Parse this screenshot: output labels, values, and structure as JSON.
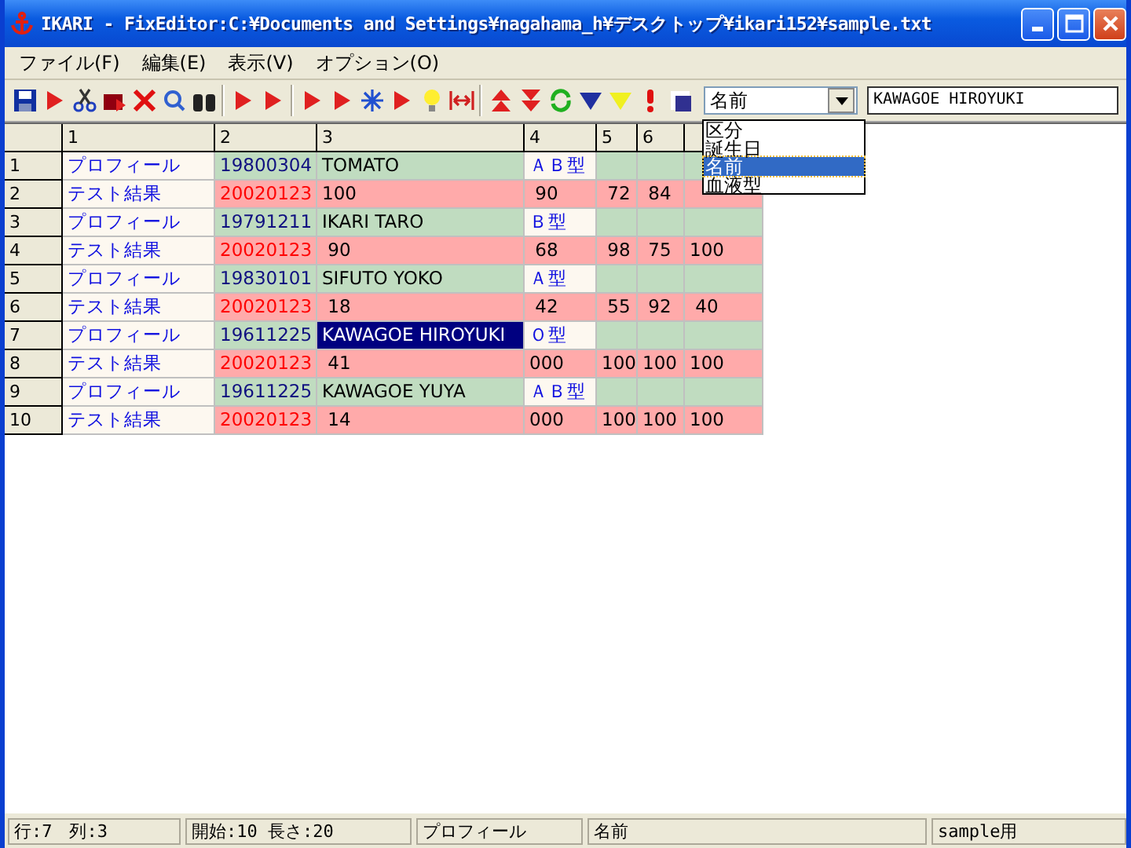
{
  "window": {
    "title": "IKARI - FixEditor:C:¥Documents and Settings¥nagahama_h¥デスクトップ¥ikari152¥sample.txt"
  },
  "menu": [
    "ファイル(F)",
    "編集(E)",
    "表示(V)",
    "オプション(O)"
  ],
  "field_selector": {
    "value": "名前",
    "expanded": true,
    "options": [
      {
        "label": "区分",
        "selected": false
      },
      {
        "label": "誕生日",
        "selected": false
      },
      {
        "label": "名前",
        "selected": true
      },
      {
        "label": "血液型",
        "selected": false
      }
    ]
  },
  "field_value": {
    "value": "KAWAGOE HIROYUKI"
  },
  "table": {
    "columns": [
      "1",
      "2",
      "3",
      "4",
      "5",
      "6"
    ],
    "rows": [
      {
        "num": "1",
        "kind": "profile",
        "cells": [
          {
            "text": "プロフィール",
            "selected": false
          },
          {
            "text": "19800304",
            "selected": false
          },
          {
            "text": "TOMATO",
            "selected": false
          },
          {
            "text": "ＡＢ型",
            "selected": false
          },
          {
            "selected": false
          },
          {
            "selected": false
          },
          {
            "selected": false
          }
        ]
      },
      {
        "num": "2",
        "kind": "test",
        "cells": [
          {
            "text": "テスト結果",
            "selected": false
          },
          {
            "text": "20020123",
            "selected": false
          },
          {
            "text": "100",
            "selected": false
          },
          {
            "text": " 90",
            "selected": false
          },
          {
            "text": " 72",
            "selected": false
          },
          {
            "text": " 84",
            "selected": false
          },
          {
            "selected": false
          }
        ]
      },
      {
        "num": "3",
        "kind": "profile",
        "cells": [
          {
            "text": "プロフィール",
            "selected": false
          },
          {
            "text": "19791211",
            "selected": false
          },
          {
            "text": "IKARI TARO",
            "selected": false
          },
          {
            "text": "Ｂ型",
            "selected": false
          },
          {
            "selected": false
          },
          {
            "selected": false
          },
          {
            "selected": false
          }
        ]
      },
      {
        "num": "4",
        "kind": "test",
        "cells": [
          {
            "text": "テスト結果",
            "selected": false
          },
          {
            "text": "20020123",
            "selected": false
          },
          {
            "text": " 90",
            "selected": false
          },
          {
            "text": " 68",
            "selected": false
          },
          {
            "text": " 98",
            "selected": false
          },
          {
            "text": " 75",
            "selected": false
          },
          {
            "text": "100",
            "selected": false
          }
        ]
      },
      {
        "num": "5",
        "kind": "profile",
        "cells": [
          {
            "text": "プロフィール",
            "selected": false
          },
          {
            "text": "19830101",
            "selected": false
          },
          {
            "text": "SIFUTO YOKO",
            "selected": false
          },
          {
            "text": "Ａ型",
            "selected": false
          },
          {
            "selected": false
          },
          {
            "selected": false
          },
          {
            "selected": false
          }
        ]
      },
      {
        "num": "6",
        "kind": "test",
        "cells": [
          {
            "text": "テスト結果",
            "selected": false
          },
          {
            "text": "20020123",
            "selected": false
          },
          {
            "text": " 18",
            "selected": false
          },
          {
            "text": " 42",
            "selected": false
          },
          {
            "text": " 55",
            "selected": false
          },
          {
            "text": " 92",
            "selected": false
          },
          {
            "text": " 40",
            "selected": false
          }
        ]
      },
      {
        "num": "7",
        "kind": "profile",
        "cells": [
          {
            "text": "プロフィール",
            "selected": false
          },
          {
            "text": "19611225",
            "selected": false
          },
          {
            "text": "KAWAGOE HIROYUKI",
            "selected": true
          },
          {
            "text": "Ｏ型",
            "selected": false
          },
          {
            "selected": false
          },
          {
            "selected": false
          },
          {
            "selected": false
          }
        ]
      },
      {
        "num": "8",
        "kind": "test",
        "cells": [
          {
            "text": "テスト結果",
            "selected": false
          },
          {
            "text": "20020123",
            "selected": false
          },
          {
            "text": " 41",
            "selected": false
          },
          {
            "text": "000",
            "selected": false
          },
          {
            "text": "100",
            "selected": false
          },
          {
            "text": "100",
            "selected": false
          },
          {
            "text": "100",
            "selected": false
          }
        ]
      },
      {
        "num": "9",
        "kind": "profile",
        "cells": [
          {
            "text": "プロフィール",
            "selected": false
          },
          {
            "text": "19611225",
            "selected": false
          },
          {
            "text": "KAWAGOE YUYA",
            "selected": false
          },
          {
            "text": "ＡＢ型",
            "selected": false
          },
          {
            "selected": false
          },
          {
            "selected": false
          },
          {
            "selected": false
          }
        ]
      },
      {
        "num": "10",
        "kind": "test",
        "cells": [
          {
            "text": "テスト結果",
            "selected": false
          },
          {
            "text": "20020123",
            "selected": false
          },
          {
            "text": " 14",
            "selected": false
          },
          {
            "text": "000",
            "selected": false
          },
          {
            "text": "100",
            "selected": false
          },
          {
            "text": "100",
            "selected": false
          },
          {
            "text": "100",
            "selected": false
          }
        ]
      }
    ]
  },
  "status_bar": [
    "行:7　列:3",
    "開始:10 長さ:20",
    "プロフィール",
    "名前",
    "sample用"
  ]
}
